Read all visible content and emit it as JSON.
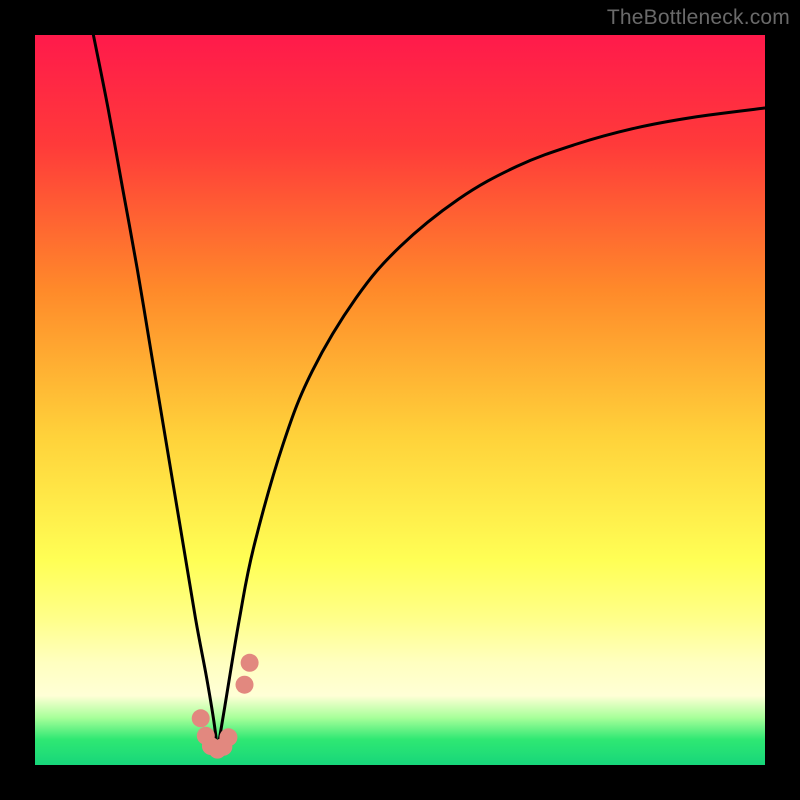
{
  "watermark": {
    "text": "TheBottleneck.com"
  },
  "chart_data": {
    "type": "line",
    "title": "",
    "xlabel": "",
    "ylabel": "",
    "xlim": [
      0,
      100
    ],
    "ylim": [
      0,
      100
    ],
    "grid": false,
    "gradient_stops": [
      {
        "offset": 0.0,
        "color": "#ff1a4b"
      },
      {
        "offset": 0.15,
        "color": "#ff3a3a"
      },
      {
        "offset": 0.35,
        "color": "#ff8a2a"
      },
      {
        "offset": 0.55,
        "color": "#ffd23a"
      },
      {
        "offset": 0.72,
        "color": "#ffff55"
      },
      {
        "offset": 0.8,
        "color": "#ffff8a"
      },
      {
        "offset": 0.86,
        "color": "#ffffc0"
      },
      {
        "offset": 0.905,
        "color": "#ffffd6"
      },
      {
        "offset": 0.935,
        "color": "#a8ff9a"
      },
      {
        "offset": 0.965,
        "color": "#2fe873"
      },
      {
        "offset": 1.0,
        "color": "#17d67a"
      }
    ],
    "bottleneck_x": 25,
    "series": [
      {
        "name": "left-branch",
        "color": "#000000",
        "x": [
          8,
          10,
          12,
          14,
          16,
          18,
          20,
          22,
          23.5,
          24.5,
          25
        ],
        "y": [
          100,
          90,
          79,
          68,
          56,
          44,
          32,
          20,
          12,
          6,
          2
        ]
      },
      {
        "name": "right-branch",
        "color": "#000000",
        "x": [
          25,
          26,
          28,
          30,
          34,
          38,
          44,
          50,
          58,
          66,
          74,
          82,
          90,
          100
        ],
        "y": [
          2,
          8,
          20,
          30,
          44,
          54,
          64,
          71,
          77.5,
          82,
          85,
          87.2,
          88.7,
          90
        ]
      }
    ],
    "markers": {
      "name": "bottleneck-markers",
      "color": "#e2887f",
      "radius_px": 9,
      "points": [
        {
          "x": 22.7,
          "y": 6.4
        },
        {
          "x": 23.4,
          "y": 4.0
        },
        {
          "x": 24.1,
          "y": 2.6
        },
        {
          "x": 25.0,
          "y": 2.1
        },
        {
          "x": 25.8,
          "y": 2.5
        },
        {
          "x": 26.5,
          "y": 3.8
        },
        {
          "x": 28.7,
          "y": 11.0
        },
        {
          "x": 29.4,
          "y": 14.0
        }
      ]
    }
  }
}
